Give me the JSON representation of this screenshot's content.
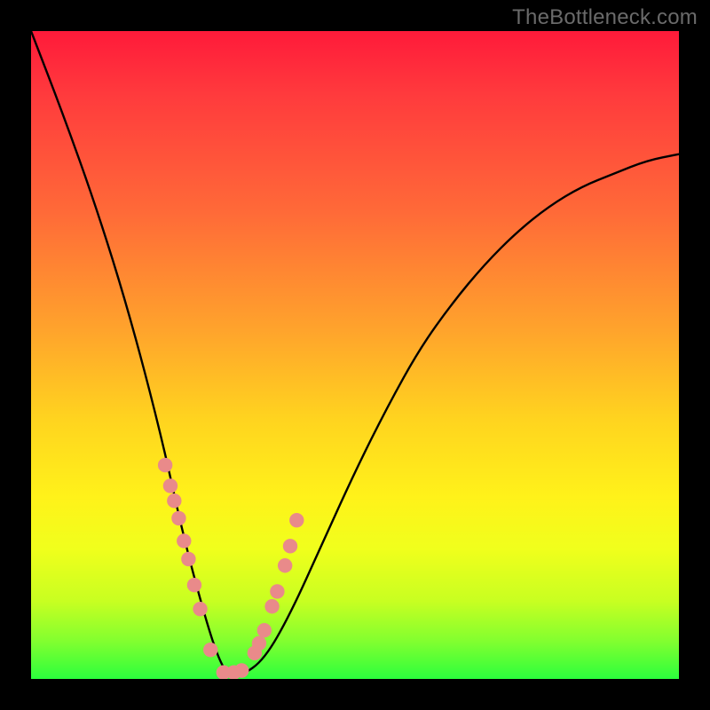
{
  "watermark": "TheBottleneck.com",
  "chart_data": {
    "type": "line",
    "title": "",
    "xlabel": "",
    "ylabel": "",
    "xlim": [
      0,
      1
    ],
    "ylim": [
      0,
      1
    ],
    "series": [
      {
        "name": "bottleneck-curve",
        "x": [
          0.0,
          0.05,
          0.1,
          0.15,
          0.2,
          0.235,
          0.27,
          0.29,
          0.305,
          0.325,
          0.36,
          0.4,
          0.45,
          0.5,
          0.55,
          0.6,
          0.65,
          0.7,
          0.75,
          0.8,
          0.85,
          0.9,
          0.95,
          1.0
        ],
        "y": [
          1.0,
          0.87,
          0.73,
          0.57,
          0.38,
          0.22,
          0.09,
          0.03,
          0.005,
          0.005,
          0.03,
          0.1,
          0.21,
          0.32,
          0.42,
          0.51,
          0.58,
          0.64,
          0.69,
          0.73,
          0.76,
          0.78,
          0.8,
          0.81
        ]
      }
    ],
    "markers": {
      "name": "highlight-dots",
      "x": [
        0.207,
        0.215,
        0.221,
        0.228,
        0.236,
        0.243,
        0.252,
        0.261,
        0.277,
        0.297,
        0.313,
        0.325,
        0.345,
        0.352,
        0.36,
        0.372,
        0.38,
        0.392,
        0.4,
        0.41
      ],
      "y": [
        0.33,
        0.298,
        0.275,
        0.248,
        0.213,
        0.185,
        0.145,
        0.108,
        0.045,
        0.01,
        0.01,
        0.013,
        0.04,
        0.055,
        0.075,
        0.112,
        0.135,
        0.175,
        0.205,
        0.245
      ]
    },
    "marker_color": "#e98a8a",
    "curve_color": "#000000"
  }
}
